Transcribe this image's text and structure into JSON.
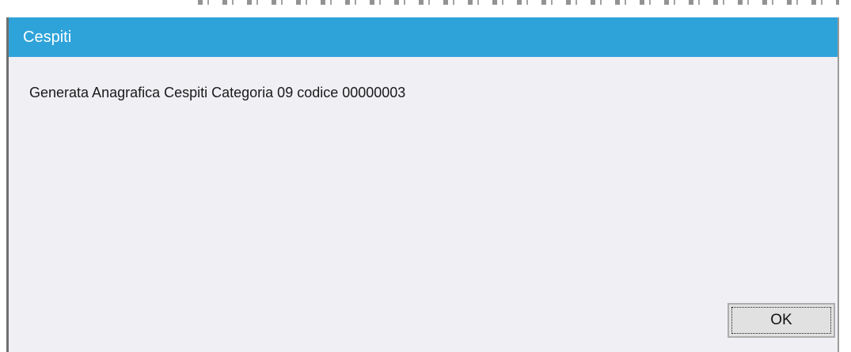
{
  "dialog": {
    "title": "Cespiti",
    "message": "Generata Anagrafica Cespiti Categoria 09 codice 00000003",
    "ok_label": "OK"
  },
  "colors": {
    "titlebar": "#2ea3da",
    "dialog_background": "#f0eff4",
    "button_background": "#e1e1e1"
  }
}
